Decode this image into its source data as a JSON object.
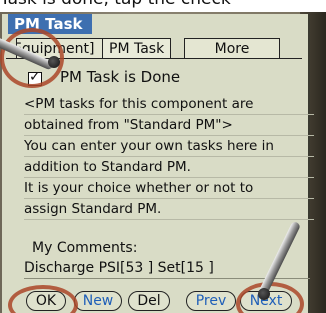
{
  "caption": "Task is done, tap the check",
  "app": {
    "title": "PM Task"
  },
  "tabs": [
    {
      "label": "Equipment]"
    },
    {
      "label": "PM Task"
    },
    {
      "label": "More"
    }
  ],
  "task": {
    "done_label": "PM Task is Done",
    "done_checked": true
  },
  "description_lines": [
    "<PM tasks for this component are",
    "obtained from \"Standard PM\">",
    "You can enter your own tasks here in",
    "addition to Standard PM.",
    "It is your choice whether or not to",
    "assign Standard PM."
  ],
  "comments": {
    "label": "My Comments:",
    "value": "Discharge PSI[53 ] Set[15 ]"
  },
  "buttons": {
    "ok": "OK",
    "new": "New",
    "del": "Del",
    "prev": "Prev",
    "next": "Next"
  },
  "colors": {
    "titlebar": "#3e6fb0",
    "highlight_ring": "#aa4628",
    "screen": "#d9dcc6"
  },
  "icons": {
    "checkmark": "check-icon",
    "stylus": "stylus-pen"
  }
}
